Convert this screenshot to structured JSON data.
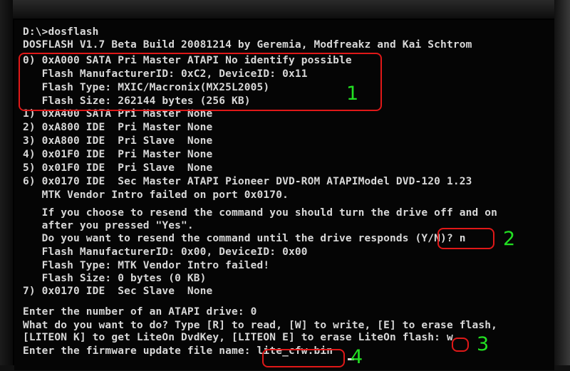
{
  "console": {
    "lines": [
      "D:\\>dosflash",
      "DOSFLASH V1.7 Beta Build 20081214 by Geremia, Modfreakz and Kai Schtrom",
      "0) 0xA000 SATA Pri Master ATAPI No identify possible",
      "   Flash ManufacturerID: 0xC2, DeviceID: 0x11",
      "   Flash Type: MXIC/Macronix(MX25L2005)",
      "   Flash Size: 262144 bytes (256 KB)",
      "1) 0xA400 SATA Pri Master None",
      "2) 0xA800 IDE  Pri Master None",
      "3) 0xA800 IDE  Pri Slave  None",
      "4) 0x01F0 IDE  Pri Master None",
      "5) 0x01F0 IDE  Pri Slave  None",
      "6) 0x0170 IDE  Sec Master ATAPI Pioneer DVD-ROM ATAPIModel DVD-120 1.23",
      "   MTK Vendor Intro failed on port 0x0170.",
      "   If you choose to resend the command you should turn the drive off and on",
      "   after you pressed \"Yes\".",
      "   Do you want to resend the command until the drive responds (Y/N)? n",
      "   Flash ManufacturerID: 0x00, DeviceID: 0x00",
      "   Flash Type: MTK Vendor Intro failed!",
      "   Flash Size: 0 bytes (0 KB)",
      "7) 0x0170 IDE  Sec Slave  None",
      "",
      "Enter the number of an ATAPI drive: 0",
      "What do you want to do? Type [R] to read, [W] to write, [E] to erase flash,",
      "[LITEON K] to get LiteOn DvdKey, [LITEON E] to erase LiteOn flash: w",
      "Enter the firmware update file name: lite_cfw.bin"
    ]
  },
  "annotations": {
    "color_ring": "#e01818",
    "color_label": "#22e022",
    "labels": [
      "1",
      "2",
      "3",
      "4"
    ]
  }
}
